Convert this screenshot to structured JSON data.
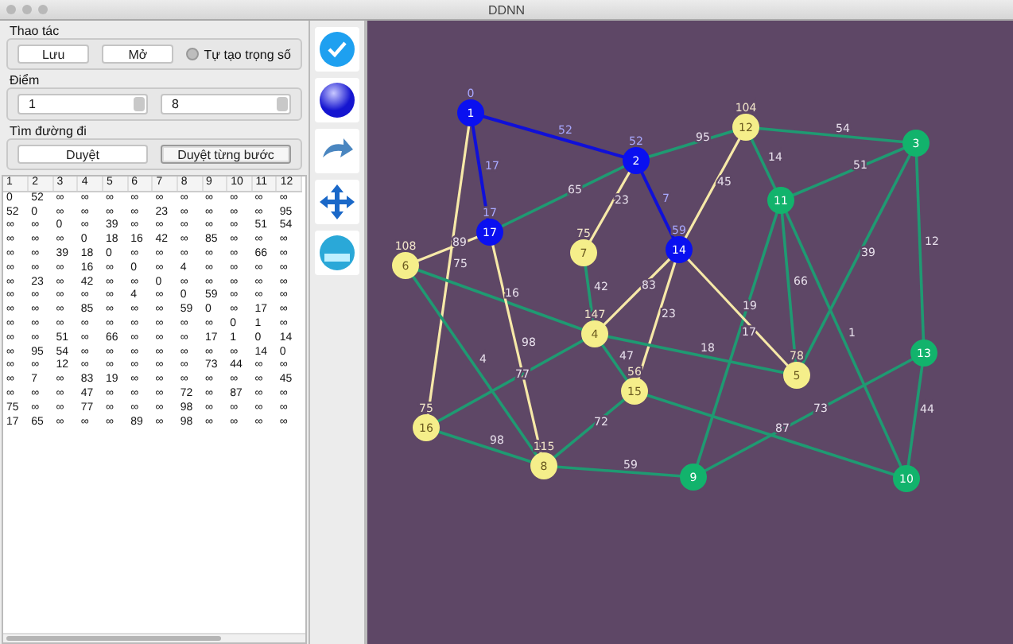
{
  "window": {
    "title": "DDNN"
  },
  "operations": {
    "title": "Thao tác",
    "buttons": [
      "Lưu",
      "Mở"
    ],
    "radio": {
      "label": "Tự tạo trọng số",
      "checked": false
    }
  },
  "points": {
    "title": "Điểm",
    "from": "1",
    "to": "8"
  },
  "pathfinding": {
    "title": "Tìm đường đi",
    "buttons": [
      {
        "label": "Duyệt",
        "selected": false
      },
      {
        "label": "Duyệt từng bước",
        "selected": true
      }
    ]
  },
  "matrix": {
    "columns": [
      "1",
      "2",
      "3",
      "4",
      "5",
      "6",
      "7",
      "8",
      "9",
      "10",
      "11",
      "12"
    ],
    "rows": [
      [
        "0",
        "52",
        "∞",
        "∞",
        "∞",
        "∞",
        "∞",
        "∞",
        "∞",
        "∞",
        "∞",
        "∞"
      ],
      [
        "52",
        "0",
        "∞",
        "∞",
        "∞",
        "∞",
        "23",
        "∞",
        "∞",
        "∞",
        "∞",
        "95"
      ],
      [
        "∞",
        "∞",
        "0",
        "∞",
        "39",
        "∞",
        "∞",
        "∞",
        "∞",
        "∞",
        "51",
        "54"
      ],
      [
        "∞",
        "∞",
        "∞",
        "0",
        "18",
        "16",
        "42",
        "∞",
        "85",
        "∞",
        "∞",
        "∞"
      ],
      [
        "∞",
        "∞",
        "39",
        "18",
        "0",
        "∞",
        "∞",
        "∞",
        "∞",
        "∞",
        "66",
        "∞"
      ],
      [
        "∞",
        "∞",
        "∞",
        "16",
        "∞",
        "0",
        "∞",
        "4",
        "∞",
        "∞",
        "∞",
        "∞"
      ],
      [
        "∞",
        "23",
        "∞",
        "42",
        "∞",
        "∞",
        "0",
        "∞",
        "∞",
        "∞",
        "∞",
        "∞"
      ],
      [
        "∞",
        "∞",
        "∞",
        "∞",
        "∞",
        "4",
        "∞",
        "0",
        "59",
        "∞",
        "∞",
        "∞"
      ],
      [
        "∞",
        "∞",
        "∞",
        "85",
        "∞",
        "∞",
        "∞",
        "59",
        "0",
        "∞",
        "17",
        "∞"
      ],
      [
        "∞",
        "∞",
        "∞",
        "∞",
        "∞",
        "∞",
        "∞",
        "∞",
        "∞",
        "0",
        "1",
        "∞"
      ],
      [
        "∞",
        "∞",
        "51",
        "∞",
        "66",
        "∞",
        "∞",
        "∞",
        "17",
        "1",
        "0",
        "14"
      ],
      [
        "∞",
        "95",
        "54",
        "∞",
        "∞",
        "∞",
        "∞",
        "∞",
        "∞",
        "∞",
        "14",
        "0"
      ],
      [
        "∞",
        "∞",
        "12",
        "∞",
        "∞",
        "∞",
        "∞",
        "∞",
        "73",
        "44",
        "∞",
        "∞"
      ],
      [
        "∞",
        "7",
        "∞",
        "83",
        "19",
        "∞",
        "∞",
        "∞",
        "∞",
        "∞",
        "∞",
        "45"
      ],
      [
        "∞",
        "∞",
        "∞",
        "47",
        "∞",
        "∞",
        "∞",
        "72",
        "∞",
        "87",
        "∞",
        "∞"
      ],
      [
        "75",
        "∞",
        "∞",
        "77",
        "∞",
        "∞",
        "∞",
        "98",
        "∞",
        "∞",
        "∞",
        "∞"
      ],
      [
        "17",
        "65",
        "∞",
        "∞",
        "∞",
        "89",
        "∞",
        "98",
        "∞",
        "∞",
        "∞",
        "∞"
      ]
    ]
  },
  "tools": [
    {
      "kind": "check"
    },
    {
      "kind": "ball"
    },
    {
      "kind": "redo"
    },
    {
      "kind": "move"
    },
    {
      "kind": "new"
    }
  ],
  "graph": {
    "nodes": [
      {
        "label": "1",
        "kind": "path",
        "distance": "0"
      },
      {
        "label": "2",
        "kind": "path",
        "distance": "52"
      },
      {
        "label": "3",
        "kind": "open"
      },
      {
        "label": "4",
        "kind": "visited",
        "distance": "147"
      },
      {
        "label": "5",
        "kind": "visited",
        "distance": "78"
      },
      {
        "label": "6",
        "kind": "visited",
        "distance": "108"
      },
      {
        "label": "7",
        "kind": "visited",
        "distance": "75"
      },
      {
        "label": "8",
        "kind": "visited",
        "distance": "115"
      },
      {
        "label": "9",
        "kind": "open"
      },
      {
        "label": "10",
        "kind": "open"
      },
      {
        "label": "11",
        "kind": "open"
      },
      {
        "label": "12",
        "kind": "visited",
        "distance": "104"
      },
      {
        "label": "13",
        "kind": "open"
      },
      {
        "label": "14",
        "kind": "path",
        "distance": "59"
      },
      {
        "label": "15",
        "kind": "visited",
        "distance": "56"
      },
      {
        "label": "16",
        "kind": "visited",
        "distance": "75"
      },
      {
        "label": "17",
        "kind": "path",
        "distance": "17"
      }
    ],
    "edges": [
      {
        "weight": "52",
        "kind": "path"
      },
      {
        "weight": "17",
        "kind": "path"
      },
      {
        "weight": "7",
        "kind": "path"
      },
      {
        "weight": "95",
        "kind": "open"
      },
      {
        "weight": "65",
        "kind": "open"
      },
      {
        "weight": "23",
        "kind": "visited"
      },
      {
        "weight": "54",
        "kind": "open"
      },
      {
        "weight": "14",
        "kind": "open"
      },
      {
        "weight": "45",
        "kind": "visited"
      },
      {
        "weight": "51",
        "kind": "open"
      },
      {
        "weight": "39",
        "kind": "open"
      },
      {
        "weight": "12",
        "kind": "open"
      },
      {
        "weight": "66",
        "kind": "open"
      },
      {
        "weight": "17",
        "kind": "open"
      },
      {
        "weight": "1",
        "kind": "open"
      },
      {
        "weight": "19",
        "kind": "visited"
      },
      {
        "weight": "83",
        "kind": "visited"
      },
      {
        "weight": "23",
        "kind": "visited"
      },
      {
        "weight": "89",
        "kind": "visited"
      },
      {
        "weight": "75",
        "kind": "visited"
      },
      {
        "weight": "16",
        "kind": "open"
      },
      {
        "weight": "4",
        "kind": "open"
      },
      {
        "weight": "98",
        "kind": "visited"
      },
      {
        "weight": "42",
        "kind": "open"
      },
      {
        "weight": "18",
        "kind": "open"
      },
      {
        "weight": "77",
        "kind": "open"
      },
      {
        "weight": "47",
        "kind": "open"
      },
      {
        "weight": "98",
        "kind": "open"
      },
      {
        "weight": "72",
        "kind": "open"
      },
      {
        "weight": "59",
        "kind": "open"
      },
      {
        "weight": "87",
        "kind": "open"
      },
      {
        "weight": "73",
        "kind": "open"
      },
      {
        "weight": "44",
        "kind": "open"
      }
    ]
  }
}
